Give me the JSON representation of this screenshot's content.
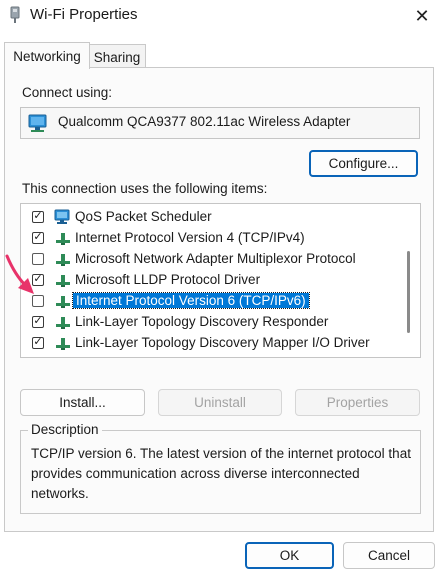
{
  "window": {
    "title": "Wi-Fi Properties",
    "close_glyph": "✕",
    "icon": "network-adapter-icon"
  },
  "tabs": [
    {
      "label": "Networking",
      "active": true
    },
    {
      "label": "Sharing",
      "active": false
    }
  ],
  "connect_using": {
    "label": "Connect using:",
    "adapter": "Qualcomm QCA9377 802.11ac Wireless Adapter",
    "configure_label": "Configure..."
  },
  "items": {
    "label": "This connection uses the following items:",
    "list": [
      {
        "label": "QoS Packet Scheduler",
        "checked": true,
        "icon": "qos-scheduler-icon"
      },
      {
        "label": "Internet Protocol Version 4 (TCP/IPv4)",
        "checked": true,
        "icon": "protocol-icon"
      },
      {
        "label": "Microsoft Network Adapter Multiplexor Protocol",
        "checked": false,
        "icon": "protocol-icon"
      },
      {
        "label": "Microsoft LLDP Protocol Driver",
        "checked": true,
        "icon": "protocol-icon"
      },
      {
        "label": "Internet Protocol Version 6 (TCP/IPv6)",
        "checked": false,
        "icon": "protocol-icon",
        "selected": true
      },
      {
        "label": "Link-Layer Topology Discovery Responder",
        "checked": true,
        "icon": "protocol-icon"
      },
      {
        "label": "Link-Layer Topology Discovery Mapper I/O Driver",
        "checked": true,
        "icon": "protocol-icon"
      }
    ]
  },
  "actions": {
    "install": "Install...",
    "uninstall": "Uninstall",
    "properties": "Properties"
  },
  "description": {
    "title": "Description",
    "text": "TCP/IP version 6. The latest version of the internet protocol that provides communication across diverse interconnected networks."
  },
  "footer": {
    "ok": "OK",
    "cancel": "Cancel"
  },
  "colors": {
    "selection": "#0078d7",
    "primary_border": "#0a64b8",
    "annotation_arrow": "#e8336a",
    "protocol_icon": "#2e8b57"
  }
}
